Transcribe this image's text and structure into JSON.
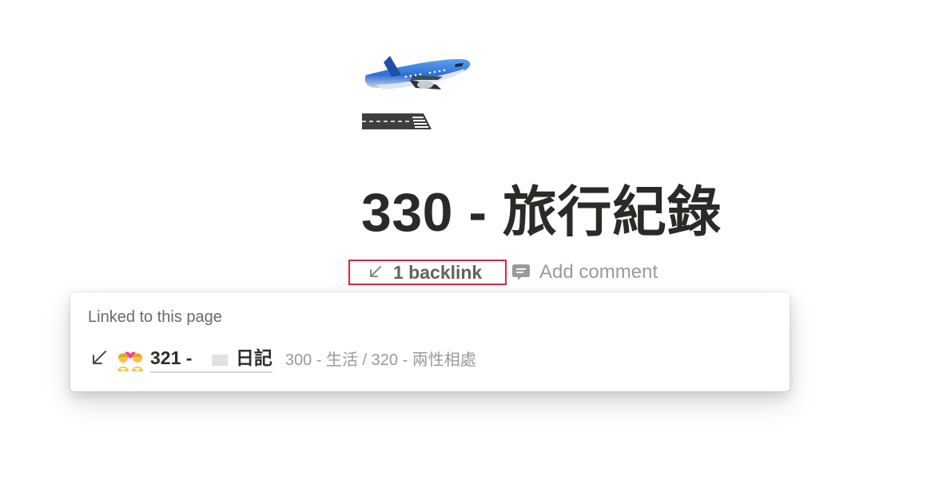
{
  "page": {
    "icon": "airplane-departure-icon",
    "title": "330 - 旅行紀錄"
  },
  "meta": {
    "backlink_icon": "arrow-down-left-icon",
    "backlink_label": "1 backlink",
    "comment_icon": "comment-icon",
    "comment_label": "Add comment"
  },
  "popup": {
    "heading": "Linked to this page",
    "items": [
      {
        "icon": "couple-with-heart-icon",
        "title_prefix": "321 - ",
        "title_suffix": "日記",
        "path": "300 - 生活 / 320 - 兩性相處"
      }
    ]
  },
  "colors": {
    "highlight_border": "#e0243c",
    "text": "#37352f",
    "muted": "#9b9a97"
  }
}
